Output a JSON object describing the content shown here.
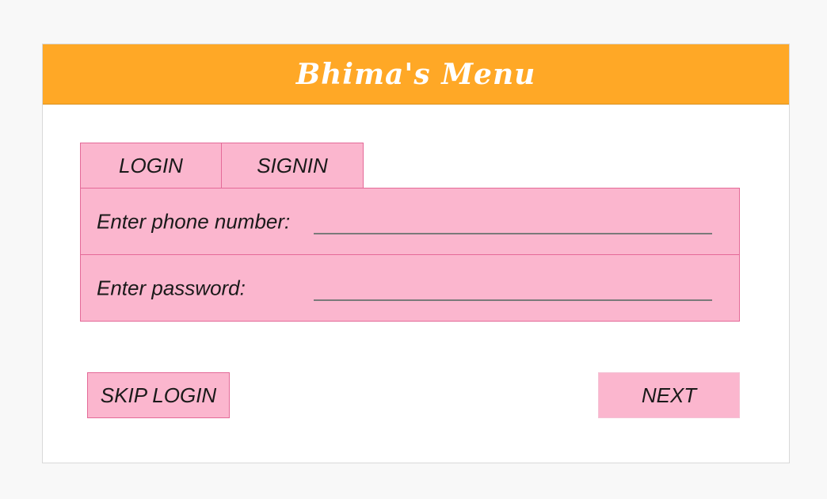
{
  "header": {
    "title": "Bhima's Menu"
  },
  "tabs": [
    {
      "label": "LOGIN"
    },
    {
      "label": "SIGNIN"
    }
  ],
  "form": {
    "phone_label": "Enter phone number:",
    "phone_value": "",
    "password_label": "Enter password:",
    "password_value": ""
  },
  "actions": {
    "skip_label": "SKIP LOGIN",
    "next_label": "NEXT"
  },
  "colors": {
    "header_bg": "#ffa826",
    "panel_bg": "#fbb6ce",
    "panel_border": "#e46a98"
  }
}
